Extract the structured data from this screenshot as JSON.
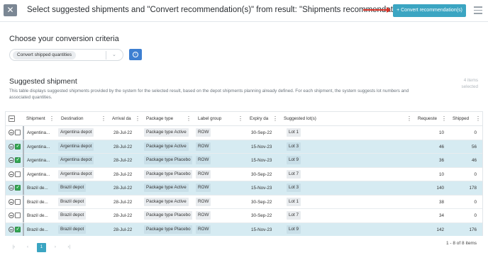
{
  "header": {
    "close_label": "✕",
    "title": "Select suggested shipments and \"Convert recommendation(s)\" from result: \"Shipments recommendations\"",
    "convert_button": "+ Convert recommendation(s)"
  },
  "criteria": {
    "title": "Choose your conversion criteria",
    "selected": "Convert shipped quantities",
    "chevron": "⌄",
    "info_icon": "i"
  },
  "suggested": {
    "title": "Suggested shipment",
    "description": "This table displays suggested shipments provided by the system for the selected result, based on the depot shipments planning already defined. For each shipment, the system suggests lot numbers and associated quantities.",
    "items_count": "4 items selected"
  },
  "table": {
    "columns": [
      "Shipment",
      "Destination",
      "Arrival da",
      "Package type",
      "Label group",
      "Expiry da",
      "Suggested lot(s)",
      "Requeste",
      "Shipped"
    ],
    "column_menu_icon": "⋮",
    "rows": [
      {
        "shipment": "Argentina...",
        "destination": "Argentina depot",
        "arrival": "28-Jul-22",
        "package": "Package type Active",
        "label": "ROW",
        "expiry": "30-Sep-22",
        "lot": "Lot 1",
        "requested": "10",
        "shipped": "0",
        "selected": false
      },
      {
        "shipment": "Argentina...",
        "destination": "Argentina depot",
        "arrival": "28-Jul-22",
        "package": "Package type Active",
        "label": "ROW",
        "expiry": "15-Nov-23",
        "lot": "Lot 3",
        "requested": "46",
        "shipped": "56",
        "selected": true
      },
      {
        "shipment": "Argentina...",
        "destination": "Argentina depot",
        "arrival": "28-Jul-22",
        "package": "Package type Placebo",
        "label": "ROW",
        "expiry": "15-Nov-23",
        "lot": "Lot 9",
        "requested": "36",
        "shipped": "46",
        "selected": true
      },
      {
        "shipment": "Argentina...",
        "destination": "Argentina depot",
        "arrival": "28-Jul-22",
        "package": "Package type Placebo",
        "label": "ROW",
        "expiry": "30-Sep-22",
        "lot": "Lot 7",
        "requested": "10",
        "shipped": "0",
        "selected": false
      },
      {
        "shipment": "Brazil de...",
        "destination": "Brazil depot",
        "arrival": "28-Jul-22",
        "package": "Package type Active",
        "label": "ROW",
        "expiry": "15-Nov-23",
        "lot": "Lot 3",
        "requested": "140",
        "shipped": "178",
        "selected": true
      },
      {
        "shipment": "Brazil de...",
        "destination": "Brazil depot",
        "arrival": "28-Jul-22",
        "package": "Package type Active",
        "label": "ROW",
        "expiry": "30-Sep-22",
        "lot": "Lot 1",
        "requested": "38",
        "shipped": "0",
        "selected": false
      },
      {
        "shipment": "Brazil de...",
        "destination": "Brazil depot",
        "arrival": "28-Jul-22",
        "package": "Package type Placebo",
        "label": "ROW",
        "expiry": "30-Sep-22",
        "lot": "Lot 7",
        "requested": "34",
        "shipped": "0",
        "selected": false
      },
      {
        "shipment": "Brazil de...",
        "destination": "Brazil depot",
        "arrival": "28-Jul-22",
        "package": "Package type Placebo",
        "label": "ROW",
        "expiry": "15-Nov-23",
        "lot": "Lot 9",
        "requested": "142",
        "shipped": "176",
        "selected": true
      }
    ]
  },
  "pager": {
    "first": "|‹",
    "prev": "‹",
    "current": "1",
    "next": "›",
    "last": "›|",
    "info": "1 - 8 of 8 items"
  },
  "colors": {
    "accent": "#3ba5c2",
    "info_button": "#3d7fd1",
    "selected_row": "#d6ebf2",
    "check_green": "#34a853",
    "arrow_red": "#d9352b"
  }
}
